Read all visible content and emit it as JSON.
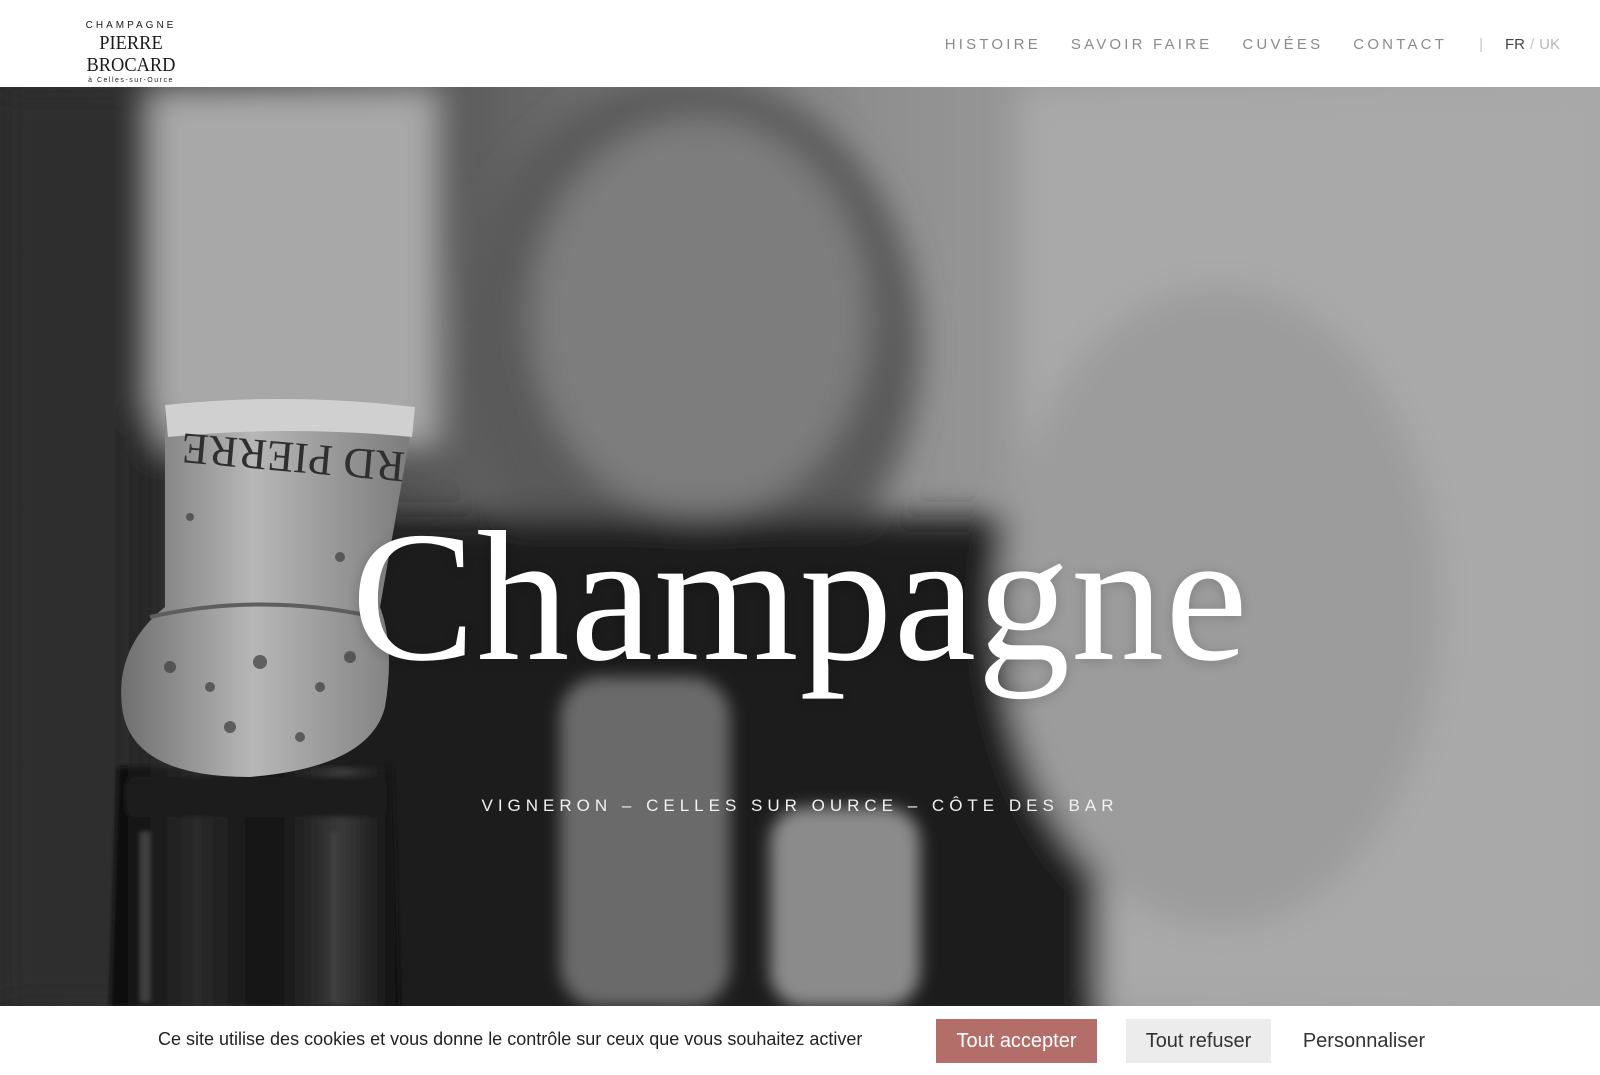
{
  "header": {
    "logo": {
      "top": "CHAMPAGNE",
      "main": "PIERRE BROCARD",
      "sub": "à Celles-sur-Ource"
    },
    "nav": [
      {
        "label": "HISTOIRE"
      },
      {
        "label": "SAVOIR FAIRE"
      },
      {
        "label": "CUVÉES"
      },
      {
        "label": "CONTACT"
      }
    ],
    "separator": "|",
    "lang": {
      "fr": "FR",
      "slash": "/",
      "uk": "UK"
    }
  },
  "hero": {
    "title": "Champagne",
    "subtitle": "VIGNERON – CELLES SUR OURCE – CÔTE DES BAR",
    "cork_text": "RD PIERRE"
  },
  "cookie": {
    "text": "Ce site utilise des cookies et vous donne le contrôle sur ceux que vous souhaitez activer",
    "accept": "Tout accepter",
    "refuse": "Tout refuser",
    "customize": "Personnaliser"
  },
  "colors": {
    "accept_button": "#b46e6a",
    "refuse_button": "#ececec",
    "nav_text": "#8a8a8a"
  }
}
